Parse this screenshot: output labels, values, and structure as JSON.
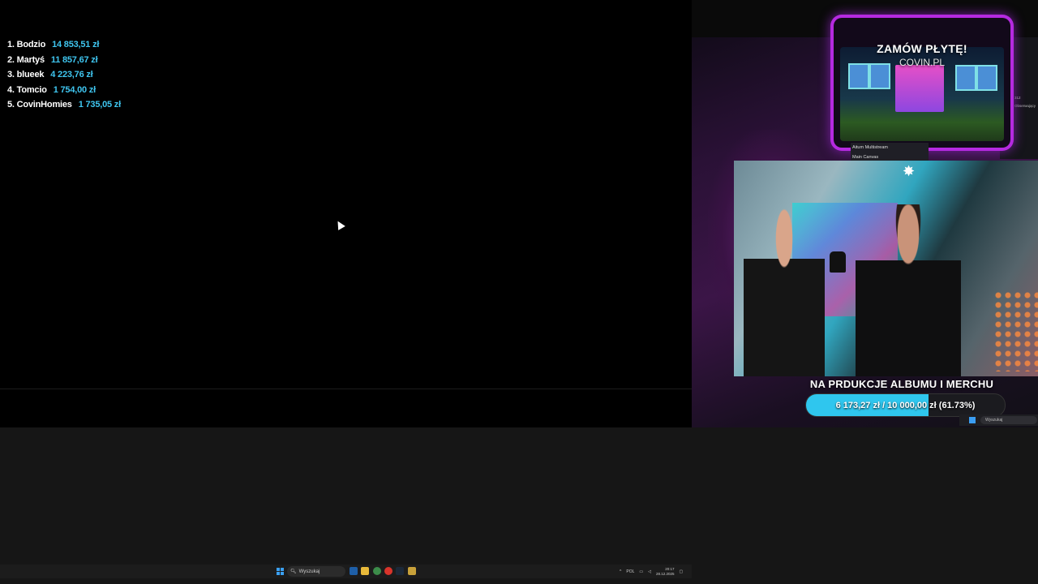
{
  "leaderboard": [
    {
      "rank_name": "1. Bodzio",
      "amount": "14 853,51 zł"
    },
    {
      "rank_name": "2. Martyś",
      "amount": "11 857,67 zł"
    },
    {
      "rank_name": "3. blueek",
      "amount": "4 223,76 zł"
    },
    {
      "rank_name": "4. Tomcio",
      "amount": "1 754,00 zł"
    },
    {
      "rank_name": "5. CovinHomies",
      "amount": "1 735,05 zł"
    }
  ],
  "promo": {
    "title": "ZAMÓW PŁYTĘ!",
    "subtitle": "COVIN.PL"
  },
  "obs": {
    "dock_title": "Aitum Multistream",
    "canvas_label": "Main Canvas",
    "side_count": "312",
    "side_label": "Obserwujący"
  },
  "goal": {
    "title": "NA PRDUKCJE ALBUMU I MERCHU",
    "label": "6 173,27 zł / 10 000,00 zł (61.73%)",
    "progress_fraction": 0.6173,
    "fill_color": "#2fc6ee"
  },
  "mini_taskbar": {
    "search_placeholder": "Wyszukaj"
  },
  "taskbar": {
    "search_placeholder": "Wyszukaj",
    "apps": [
      "explorer-icon",
      "files-icon",
      "browser-icon",
      "chrome-icon",
      "steam-icon",
      "app-icon"
    ],
    "tray_lang": "POL",
    "time": "20:17",
    "date": "28.12.2025"
  }
}
